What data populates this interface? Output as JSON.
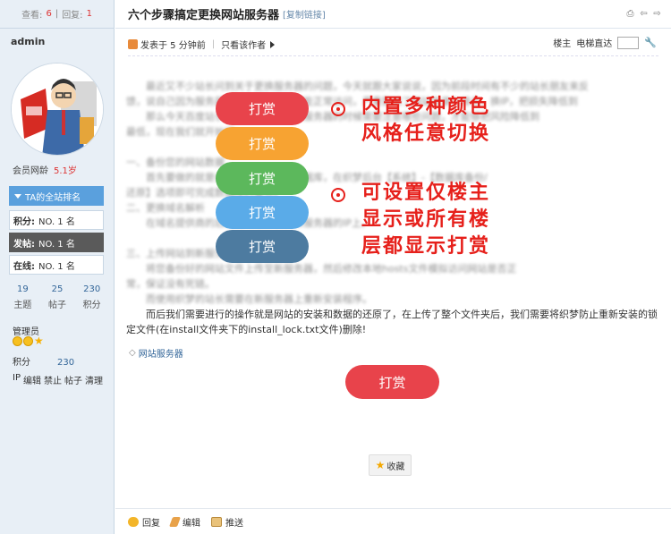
{
  "sidebar": {
    "views_label": "查看:",
    "views": "6",
    "replies_label": "回复:",
    "replies": "1",
    "username": "admin",
    "member_age_label": "会员网龄",
    "member_age": "5.1岁",
    "rank_header": "TA的全站排名",
    "ranks": [
      {
        "label": "积分:",
        "value": "NO. 1 名"
      },
      {
        "label": "发帖:",
        "value": "NO. 1 名"
      },
      {
        "label": "在线:",
        "value": "NO. 1 名"
      }
    ],
    "counts": [
      {
        "num": "19",
        "label": "主题"
      },
      {
        "num": "25",
        "label": "帖子"
      },
      {
        "num": "230",
        "label": "积分"
      }
    ],
    "group": "管理员",
    "points_label": "积分",
    "points": "230",
    "admin_tools": [
      "IP",
      "编辑",
      "禁止",
      "帖子",
      "清理"
    ]
  },
  "post": {
    "title": "六个步骤搞定更换网站服务器",
    "copy_link": "[复制链接]",
    "posted": "发表于 5 分钟前",
    "only_author": "只看该作者",
    "floor_label": "楼主",
    "jump_label": "电梯直达",
    "article_lines": [
      "　　最近又不少站长问到关于更换服务器的问题，今天就跟大家说说，因为前段时间有不少的站长朋友来反",
      "馈，说自己因为服务器的问题导致网站不能正常访问，严重影响了网站收录与排名，换IP，把损失降低到",
      "　　那么今天百度站长就告诉大家在更换服务器的时候需要注意哪些问题，才能够把风险降低到",
      "最低，现在我们就开始吧：",
      "",
      "一、备份您的网站数据",
      "　　首先要做的就是备份网站程序以及数据库，在织梦后台【系统】-【数据库备份/",
      "还原】选项即可完成数据库的备份。",
      "二、更换域名解析",
      "　　在域名提供商的后台将域名解析到新服务器的IP上。",
      "",
      "三、上传网站到新服务器",
      "　　将您备份好的网站文件上传至新服务器，然后修改本地hosts文件模拟访问网站是否正",
      "常，保证没有死链。",
      "　　而使用织梦的站长需要在新服务器上重新安装程序。",
      "　　而后我们需要进行的操作就是网站的安装和数据的还原了，在上传了整个文件夹后，我们需要将织梦防止重新安装的锁",
      "定文件(在install文件夹下的install_lock.txt文件)删除!"
    ],
    "reward_buttons": [
      "打赏",
      "打赏",
      "打赏",
      "打赏",
      "打赏"
    ],
    "reward_colors": [
      "#e8434b",
      "#f7a332",
      "#5cb85c",
      "#5aabe8",
      "#4d7ba0"
    ],
    "promo_lines_1": [
      "内置多种颜色",
      "风格任意切换"
    ],
    "promo_lines_2": [
      "可设置仅楼主",
      "显示或所有楼",
      "层都显示打赏"
    ],
    "tag": "网站服务器",
    "main_reward": "打赏",
    "favorite": "收藏",
    "bottom_actions": [
      "回复",
      "编辑",
      "推送"
    ]
  },
  "colors": {
    "sidebar_bg": "#e8eff6",
    "accent_blue": "#5aa0dd",
    "promo_red": "#e6201b"
  }
}
